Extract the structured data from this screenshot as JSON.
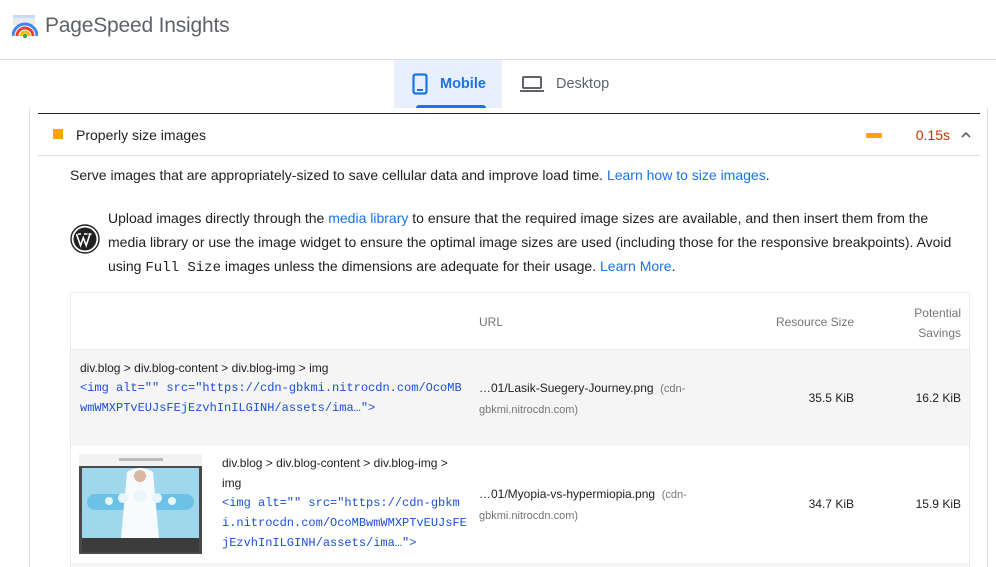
{
  "app": {
    "title": "PageSpeed Insights"
  },
  "tabs": [
    {
      "label": "Mobile",
      "active": true,
      "icon": "smartphone-icon"
    },
    {
      "label": "Desktop",
      "active": false,
      "icon": "laptop-icon"
    }
  ],
  "audit": {
    "title": "Properly size images",
    "savings": "0.15s",
    "status_color": "#ffa400",
    "value_color": "#c33300",
    "description": "Serve images that are appropriately-sized to save cellular data and improve load time. ",
    "learn_link": "Learn how to size images",
    "description_end": "."
  },
  "stack_pack": {
    "icon": "wordpress-icon",
    "text_1": "Upload images directly through the ",
    "link_1": "media library",
    "text_2": " to ensure that the required image sizes are available, and then insert them from the media library or use the image widget to ensure the optimal image sizes are used (including those for the responsive breakpoints). Avoid using ",
    "code": "Full Size",
    "text_3": " images unless the dimensions are adequate for their usage. ",
    "link_2": "Learn More",
    "text_4": "."
  },
  "table": {
    "headers": {
      "url": "URL",
      "size": "Resource Size",
      "savings_1": "Potential",
      "savings_2": "Savings"
    },
    "rows": [
      {
        "node_path": "div.blog > div.blog-content > div.blog-img > img",
        "snippet": "<img alt=\"\" src=\"https://cdn-gbkmi.nitrocdn.com/OcoMBwmWMXPTvEUJsFEjEzvhInILGINH/assets/ima…\">",
        "url": "…01/Lasik-Suegery-Journey.png",
        "host": "(cdn-gbkmi.nitrocdn.com)",
        "size": "35.5 KiB",
        "savings": "16.2 KiB"
      },
      {
        "node_path": "div.blog > div.blog-content > div.blog-img > img",
        "snippet": "<img alt=\"\" src=\"https://cdn-gbkmi.nitrocdn.com/OcoMBwmWMXPTvEUJsFEjEzvhInILGINH/assets/ima…\">",
        "url": "…01/Myopia-vs-hypermiopia.png",
        "host": "(cdn-gbkmi.nitrocdn.com)",
        "size": "34.7 KiB",
        "savings": "15.9 KiB"
      }
    ]
  }
}
